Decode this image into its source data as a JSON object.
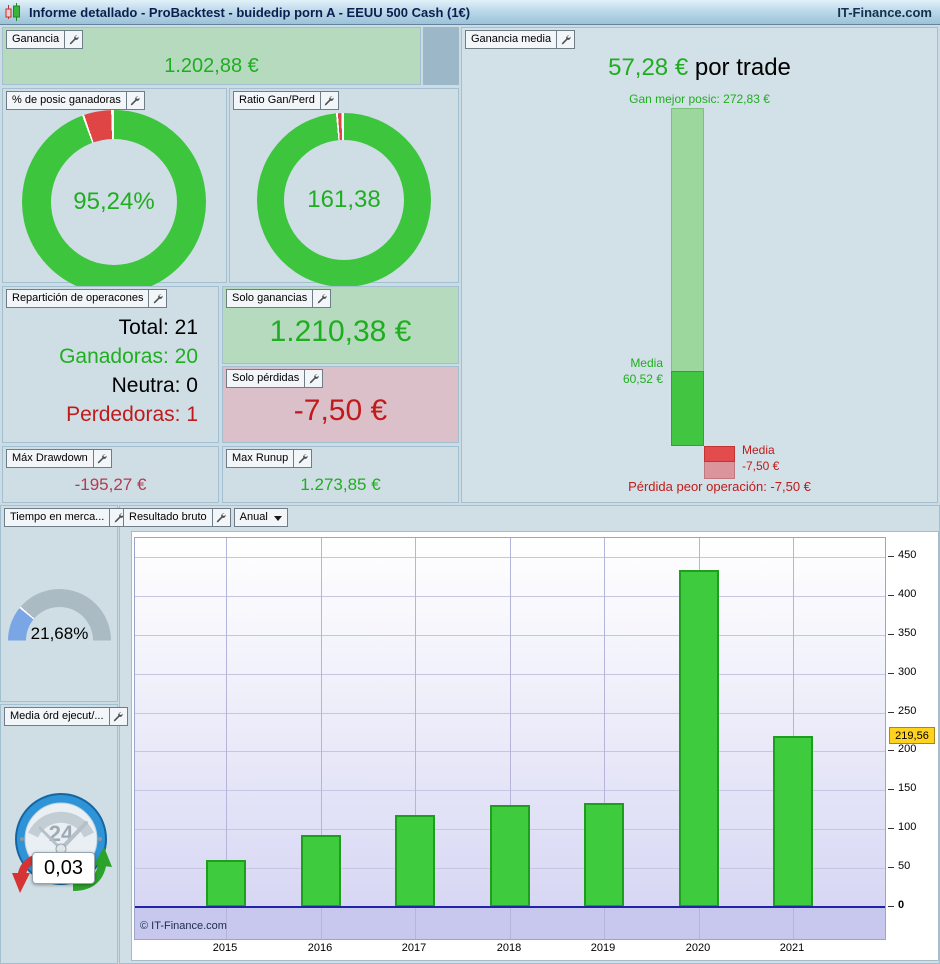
{
  "title_bar": {
    "title": "Informe detallado - ProBacktest - buidedip porn A - EEUU 500 Cash (1€)",
    "brand": "IT-Finance.com"
  },
  "left": {
    "ganancia": {
      "label": "Ganancia",
      "value": "1.202,88 €"
    },
    "pct_ganadoras": {
      "label": "% de posic ganadoras",
      "value": "95,24%"
    },
    "ratio": {
      "label": "Ratio Gan/Perd",
      "value": "161,38"
    },
    "reparticion": {
      "label": "Repartición de operacones",
      "rows": [
        {
          "text": "Total: 21"
        },
        {
          "text": "Ganadoras: 20"
        },
        {
          "text": "Neutra: 0"
        },
        {
          "text": "Perdedoras: 1"
        }
      ]
    },
    "solo_ganancias": {
      "label": "Solo ganancias",
      "value": "1.210,38 €"
    },
    "solo_perdidas": {
      "label": "Solo pérdidas",
      "value": "-7,50 €"
    },
    "max_drawdown": {
      "label": "Máx Drawdown",
      "value": "-195,27 €"
    },
    "max_runup": {
      "label": "Max Runup",
      "value": "1.273,85 €"
    }
  },
  "ganancia_media": {
    "label": "Ganancia media",
    "value": "57,28 €",
    "suffix": " por trade",
    "best": "Gan mejor posic: 272,83 €",
    "media_label": "Media",
    "media_value": "60,52 €",
    "loss_label": "Media",
    "loss_value": "-7,50 €",
    "worst": "Pérdida peor operación: -7,50 €"
  },
  "tiempo": {
    "label": "Tiempo en merca...",
    "value": "21,68%"
  },
  "media_ord": {
    "label": "Media órd ejecut/...",
    "value": "0,03",
    "clock_text": "24"
  },
  "resultado": {
    "label": "Resultado bruto",
    "period": "Anual"
  },
  "chart_data": [
    {
      "id": "pct_posic_ganadoras",
      "type": "pie",
      "donut": true,
      "title": "% de posic ganadoras",
      "slices": [
        {
          "label": "ganadoras",
          "value": 95.24,
          "color": "#3dc53d"
        },
        {
          "label": "perdedoras",
          "value": 4.76,
          "color": "#e04545"
        }
      ],
      "center_label": "95,24%"
    },
    {
      "id": "ratio_gan_perd",
      "type": "pie",
      "donut": true,
      "title": "Ratio Gan/Perd",
      "slices": [
        {
          "label": "ganancias",
          "value": 99.38,
          "color": "#3dc53d"
        },
        {
          "label": "perdidas",
          "value": 0.62,
          "color": "#e04545"
        }
      ],
      "center_label": "161,38"
    },
    {
      "id": "ganancia_media",
      "type": "bar",
      "title": "Ganancia media (€ por trade)",
      "best_gain": 272.83,
      "media_gain": 60.52,
      "media_loss": -7.5,
      "worst_loss": -7.5,
      "avg_per_trade": 57.28
    },
    {
      "id": "tiempo_en_mercado",
      "type": "gauge",
      "title": "Tiempo en mercado",
      "value_pct": 21.68,
      "range": [
        0,
        100
      ],
      "colors": {
        "value": "#7aa6e6",
        "rest": "#aabbc4"
      }
    },
    {
      "id": "resultado_bruto",
      "type": "bar",
      "title": "Resultado bruto",
      "period": "Anual",
      "categories": [
        "2015",
        "2016",
        "2017",
        "2018",
        "2019",
        "2020",
        "2021"
      ],
      "values": [
        60.5,
        92.5,
        118,
        131,
        134,
        433.5,
        219.56
      ],
      "ylim": [
        0,
        470
      ],
      "yticks": [
        0,
        50,
        100,
        150,
        200,
        250,
        300,
        350,
        400,
        450
      ],
      "highlight": {
        "value": 219.56,
        "label": "219,56"
      },
      "watermark": "© IT-Finance.com",
      "grid": true,
      "legend": "none"
    }
  ]
}
